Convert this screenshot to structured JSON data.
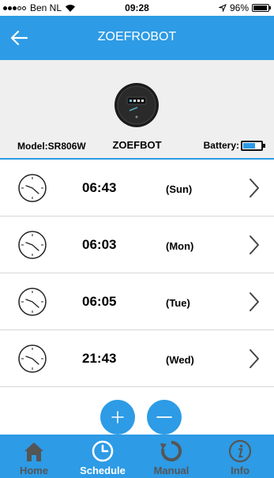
{
  "status": {
    "carrier": "Ben NL",
    "time": "09:28",
    "battery_percent": "96%",
    "battery_level": 0.96
  },
  "header": {
    "title": "ZOEFROBOT"
  },
  "device": {
    "model_label": "Model:",
    "model_value": "SR806W",
    "name": "ZOEFBOT",
    "battery_label": "Battery:",
    "battery_level": 0.7
  },
  "schedules": [
    {
      "time": "06:43",
      "day": "(Sun)"
    },
    {
      "time": "06:03",
      "day": "(Mon)"
    },
    {
      "time": "06:05",
      "day": "(Tue)"
    },
    {
      "time": "21:43",
      "day": "(Wed)"
    }
  ],
  "tabs": [
    {
      "label": "Home",
      "icon": "home-icon"
    },
    {
      "label": "Schedule",
      "icon": "clock-icon"
    },
    {
      "label": "Manual",
      "icon": "refresh-icon"
    },
    {
      "label": "Info",
      "icon": "info-icon"
    }
  ],
  "active_tab": "Schedule",
  "colors": {
    "accent": "#2d9be5",
    "panel": "#efefef"
  }
}
